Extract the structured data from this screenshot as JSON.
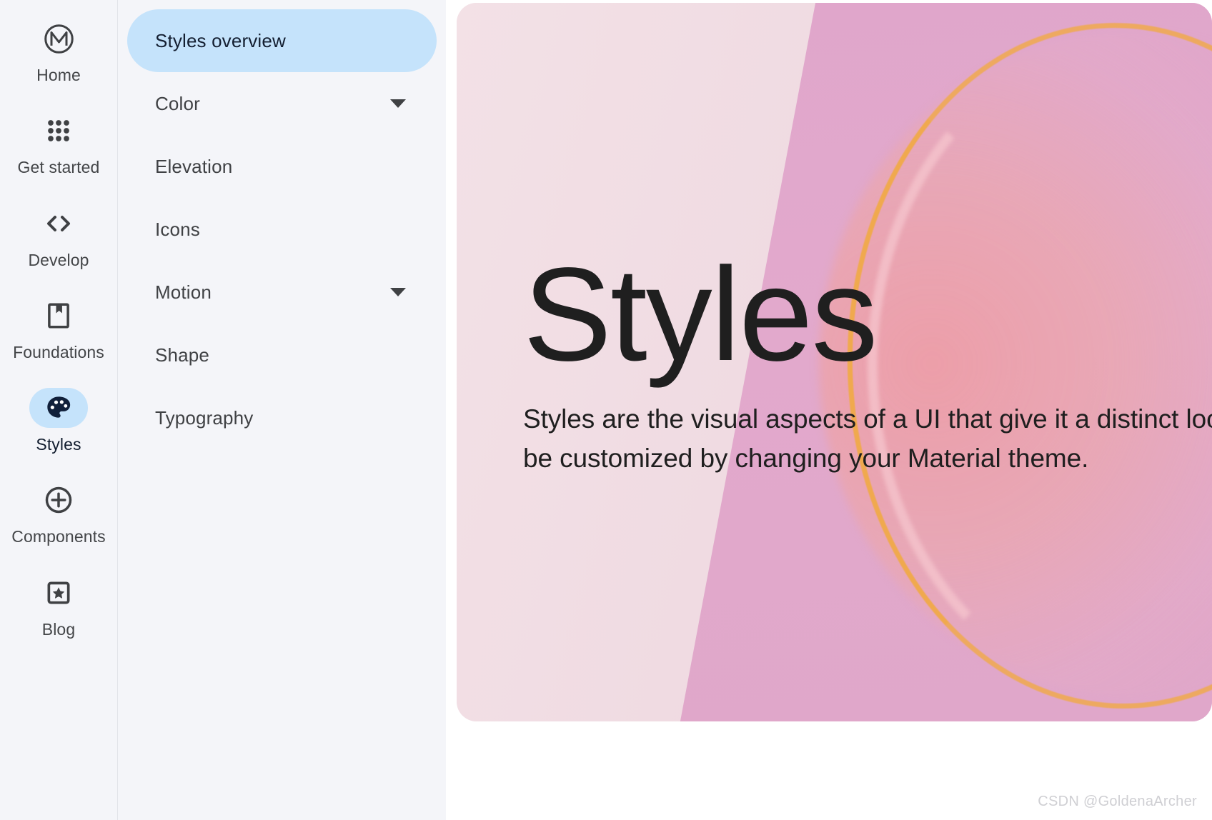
{
  "rail": {
    "items": [
      {
        "label": "Home",
        "icon": "material-m-logo-icon",
        "active": false
      },
      {
        "label": "Get started",
        "icon": "grid-dots-icon",
        "active": false
      },
      {
        "label": "Develop",
        "icon": "code-brackets-icon",
        "active": false
      },
      {
        "label": "Foundations",
        "icon": "bookmark-book-icon",
        "active": false
      },
      {
        "label": "Styles",
        "icon": "palette-icon",
        "active": true
      },
      {
        "label": "Components",
        "icon": "plus-circle-icon",
        "active": false
      },
      {
        "label": "Blog",
        "icon": "star-square-icon",
        "active": false
      }
    ]
  },
  "nav": {
    "items": [
      {
        "label": "Styles overview",
        "expandable": false,
        "active": true
      },
      {
        "label": "Color",
        "expandable": true,
        "active": false
      },
      {
        "label": "Elevation",
        "expandable": false,
        "active": false
      },
      {
        "label": "Icons",
        "expandable": false,
        "active": false
      },
      {
        "label": "Motion",
        "expandable": true,
        "active": false
      },
      {
        "label": "Shape",
        "expandable": false,
        "active": false
      },
      {
        "label": "Typography",
        "expandable": false,
        "active": false
      }
    ]
  },
  "hero": {
    "title": "Styles",
    "subtitle": "Styles are the visual aspects of a UI that give it a distinct look. They can be customized by changing your Material theme."
  },
  "watermark": "CSDN @GoldenaArcher",
  "colors": {
    "rail_background": "#f4f5f9",
    "nav_background": "#f4f5f9",
    "active_pill": "#c5e3fb",
    "active_text": "#141f31",
    "label_text": "#3f4144",
    "hero_light_pink": "#f0dce3",
    "hero_deep_pink": "#e1a8cb",
    "hero_orange_arc": "#f0a94e",
    "hero_text": "#1f1f1f",
    "content_background": "#ffffff"
  }
}
